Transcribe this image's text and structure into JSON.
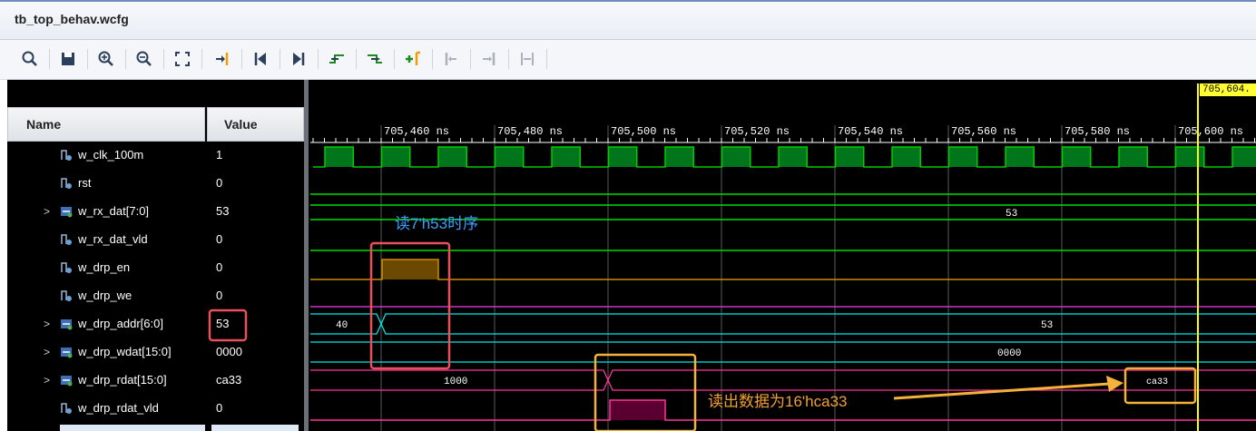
{
  "window": {
    "title": "tb_top_behav.wcfg"
  },
  "toolbar": {
    "icons": [
      "search-icon",
      "save-icon",
      "zoom-in-icon",
      "zoom-out-icon",
      "zoom-fit-icon",
      "go-to-cursor-icon",
      "go-to-start-icon",
      "go-to-end-icon",
      "previous-transition-icon",
      "next-transition-icon",
      "add-marker-icon",
      "previous-marker-icon",
      "next-marker-icon",
      "swap-cursors-icon"
    ]
  },
  "columns": {
    "name": "Name",
    "value": "Value"
  },
  "signals": [
    {
      "name": "w_clk_100m",
      "value": "1",
      "bus": false
    },
    {
      "name": "rst",
      "value": "0",
      "bus": false
    },
    {
      "name": "w_rx_dat[7:0]",
      "value": "53",
      "bus": true
    },
    {
      "name": "w_rx_dat_vld",
      "value": "0",
      "bus": false
    },
    {
      "name": "w_drp_en",
      "value": "0",
      "bus": false
    },
    {
      "name": "w_drp_we",
      "value": "0",
      "bus": false
    },
    {
      "name": "w_drp_addr[6:0]",
      "value": "53",
      "bus": true
    },
    {
      "name": "w_drp_wdat[15:0]",
      "value": "0000",
      "bus": true
    },
    {
      "name": "w_drp_rdat[15:0]",
      "value": "ca33",
      "bus": true
    },
    {
      "name": "w_drp_rdat_vld",
      "value": "0",
      "bus": false
    }
  ],
  "timeline": {
    "ticks": [
      "705,460 ns",
      "705,480 ns",
      "705,500 ns",
      "705,520 ns",
      "705,540 ns",
      "705,560 ns",
      "705,580 ns",
      "705,600 ns"
    ],
    "cursor_label": "705,604.",
    "cursor_time_ns": 705604
  },
  "waveforms": {
    "rx_dat_value": "53",
    "addr_before": "40",
    "addr_after": "53",
    "wdat_value": "0000",
    "rdat_before": "1000",
    "rdat_after": "ca33"
  },
  "annotations": {
    "read_timing": "读7'h53时序",
    "read_result": "读出数据为16'hca33"
  },
  "colors": {
    "clock": "#00cc00",
    "signal_line": "#00dd00",
    "bus_line": "#00e5e5",
    "pink_line": "#ff3399",
    "en_fill": "#6b4a00",
    "en_line": "#d08a00",
    "vld_fill": "#5a0030",
    "cursor": "#ffff00",
    "red_box": "#e8505b",
    "orange_box": "#f5b13a"
  }
}
